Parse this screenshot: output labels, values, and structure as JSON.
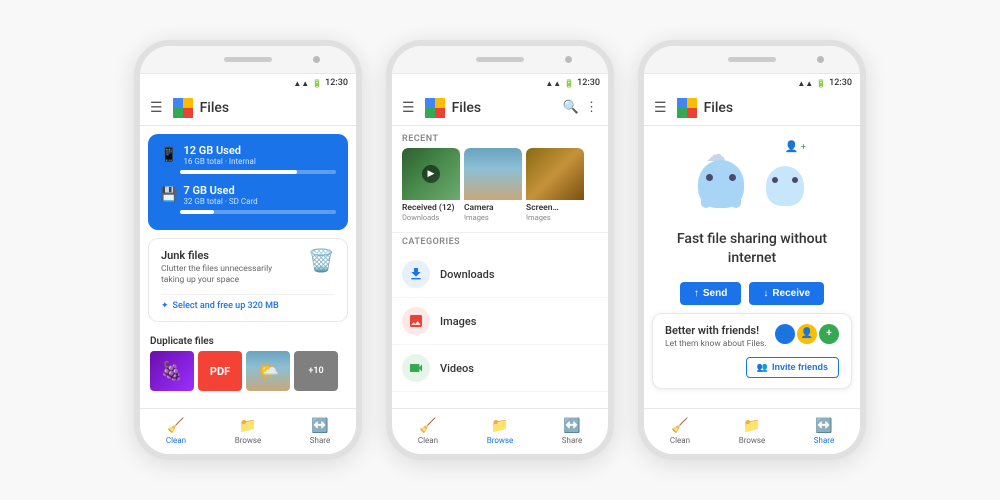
{
  "app": {
    "title": "Files",
    "status_time": "12:30"
  },
  "phone1": {
    "storage1_title": "12 GB Used",
    "storage1_subtitle": "16 GB total · Internal",
    "storage1_fill": "75%",
    "storage2_title": "7 GB Used",
    "storage2_subtitle": "32 GB total · SD Card",
    "storage2_fill": "22%",
    "junk_title": "Junk files",
    "junk_desc": "Clutter the files unnecessarily taking up your space",
    "junk_action": "Select and free up 320 MB",
    "section_duplicate": "Duplicate files"
  },
  "phone2": {
    "recent_label": "RECENT",
    "recent_items": [
      {
        "label": "Received (12)",
        "sub": "Downloads"
      },
      {
        "label": "Camera",
        "sub": "Images"
      },
      {
        "label": "Screen…",
        "sub": "Images"
      }
    ],
    "categories_label": "CATEGORIES",
    "categories": [
      {
        "name": "Downloads",
        "color": "#1a73e8"
      },
      {
        "name": "Images",
        "color": "#ea4335"
      },
      {
        "name": "Videos",
        "color": "#34a853"
      }
    ]
  },
  "phone3": {
    "sharing_title": "Fast file sharing without internet",
    "send_label": "Send",
    "receive_label": "Receive",
    "friends_title": "Better with friends!",
    "friends_sub": "Let them know about Files.",
    "invite_label": "Invite friends"
  },
  "nav": {
    "clean": "Clean",
    "browse": "Browse",
    "share": "Share"
  }
}
